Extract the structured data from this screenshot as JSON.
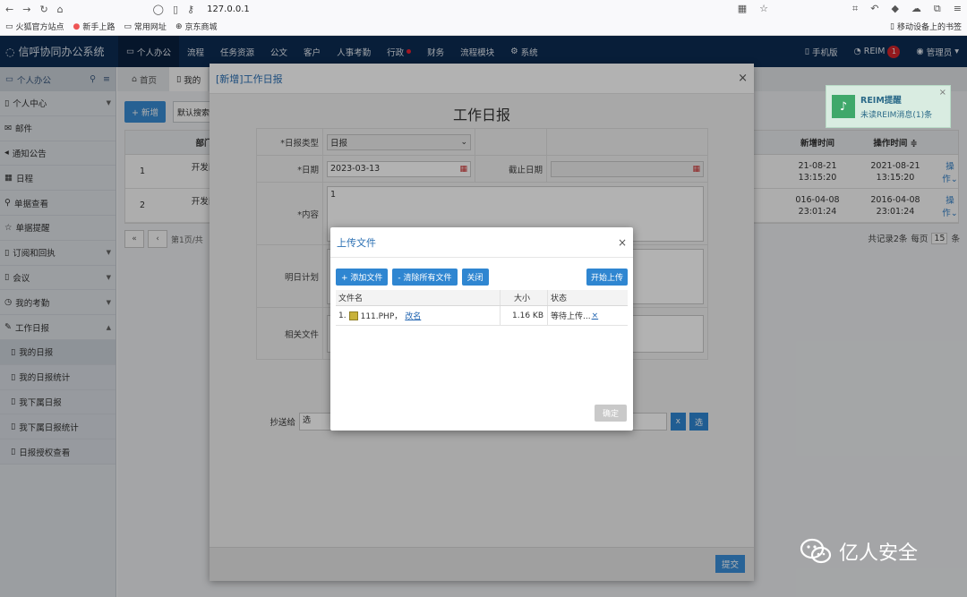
{
  "browser": {
    "url": "127.0.0.1",
    "bookmarks": [
      "火狐官方站点",
      "新手上路",
      "常用网址",
      "京东商城"
    ],
    "mobile_bookmarks": "移动设备上的书签"
  },
  "navbar": {
    "brand": "信呼协同办公系统",
    "items": [
      "个人办公",
      "流程",
      "任务资源",
      "公文",
      "客户",
      "人事考勤",
      "行政",
      "财务",
      "流程模块",
      "系统"
    ],
    "mobile": "手机版",
    "reim": "REIM",
    "reim_count": "1",
    "user": "管理员"
  },
  "sidebar": {
    "header": "个人办公",
    "items": [
      {
        "label": "个人中心",
        "caret": "▼"
      },
      {
        "label": "邮件",
        "caret": ""
      },
      {
        "label": "通知公告",
        "caret": ""
      },
      {
        "label": "日程",
        "caret": ""
      },
      {
        "label": "单据查看",
        "caret": ""
      },
      {
        "label": "单据提醒",
        "caret": ""
      },
      {
        "label": "订阅和回执",
        "caret": "▼"
      },
      {
        "label": "会议",
        "caret": "▼"
      },
      {
        "label": "我的考勤",
        "caret": "▼"
      },
      {
        "label": "工作日报",
        "caret": "▲"
      }
    ],
    "subitems": [
      "我的日报",
      "我的日报统计",
      "我下属日报",
      "我下属日报统计",
      "日报授权查看"
    ]
  },
  "main": {
    "tabs": [
      "首页",
      "我的"
    ],
    "new_button": "+ 新增",
    "search_default": "默认搜索",
    "table_headers": [
      "部门",
      "新增时间",
      "操作时间 ≑"
    ],
    "rows": [
      {
        "no": "1",
        "dept": "开发部",
        "add_d": "21-08-21",
        "add_t": "13:15:20",
        "op_d": "2021-08-21",
        "op_t": "13:15:20",
        "action": "操作⌄"
      },
      {
        "no": "2",
        "dept": "开发部",
        "add_d": "016-04-08",
        "add_t": "23:01:24",
        "op_d": "2016-04-08",
        "op_t": "23:01:24",
        "action": "操作⌄"
      }
    ],
    "pager": {
      "first": "«",
      "prev": "‹",
      "text": "第1页/共",
      "total": "共记录2条",
      "per_page_label": "每页",
      "per_page": "15",
      "unit": "条"
    }
  },
  "toast": {
    "title": "REIM提醒",
    "message": "未读REIM消息(1)条"
  },
  "modal": {
    "title": "[新增]工作日报",
    "form_title": "工作日报",
    "fields": {
      "type_label": "*日报类型",
      "type_value": "日报",
      "date_label": "*日期",
      "date_value": "2023-03-13",
      "end_date_label": "截止日期",
      "content_label": "*内容",
      "content_value": "1",
      "plan_label": "明日计划",
      "files_label": "相关文件",
      "cc_label": "抄送给",
      "cc_placeholder": "选",
      "cc_clear": "x",
      "cc_select": "选"
    },
    "submit": "提交"
  },
  "upload": {
    "title": "上传文件",
    "add_file": "+ 添加文件",
    "clear_files": "- 清除所有文件",
    "close": "关闭",
    "start": "开始上传",
    "headers": [
      "文件名",
      "大小",
      "状态"
    ],
    "file": {
      "index": "1.",
      "name": "111.PHP，",
      "rename": "改名",
      "size": "1.16 KB",
      "status": "等待上传...",
      "remove": "×"
    },
    "confirm": "确定"
  },
  "watermark": "亿人安全"
}
